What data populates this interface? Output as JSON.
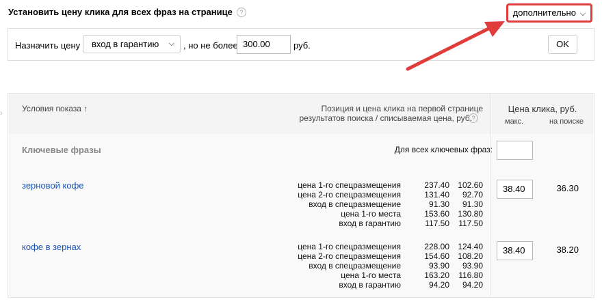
{
  "header": {
    "title": "Установить цену клика для всех фраз на странице",
    "help": "?",
    "advanced_button": "дополнительно"
  },
  "bid_panel": {
    "assign_label": "Назначить цену",
    "strategy_value": "вход в гарантию",
    "not_more_label": ", но не более",
    "max_price_value": "300.00",
    "currency": "руб.",
    "ok_label": "OK"
  },
  "table": {
    "col_conditions": "Условия показа ↑",
    "col_position_line1": "Позиция и цена клика на первой странице",
    "col_position_line2": "результатов поиска / списываемая цена, руб.",
    "col_bid": "Цена клика, руб.",
    "col_bid_max": "макс.",
    "col_bid_search": "на поиске",
    "section_label": "Ключевые фразы",
    "all_phrases_label": "Для всех ключевых фраз:",
    "all_phrases_value": "",
    "rows": [
      {
        "phrase": "зерновой кофе",
        "positions": [
          "цена 1-го спецразмещения",
          "цена 2-го спецразмещения",
          "вход в спецразмещение",
          "цена 1-го места",
          "вход в гарантию"
        ],
        "bids": [
          "237.40",
          "131.40",
          "91.30",
          "153.60",
          "117.50"
        ],
        "charged": [
          "102.60",
          "92.70",
          "91.30",
          "130.80",
          "117.50"
        ],
        "max_bid": "38.40",
        "search_bid": "36.30"
      },
      {
        "phrase": "кофе в зернах",
        "positions": [
          "цена 1-го спецразмещения",
          "цена 2-го спецразмещения",
          "вход в спецразмещение",
          "цена 1-го места",
          "вход в гарантию"
        ],
        "bids": [
          "228.00",
          "154.60",
          "93.90",
          "163.20",
          "94.20"
        ],
        "charged": [
          "124.40",
          "108.20",
          "93.90",
          "116.80",
          "94.20"
        ],
        "max_bid": "38.40",
        "search_bid": "38.20"
      }
    ]
  },
  "icons": {
    "help": "help-circle-icon",
    "dropdown": "chevron-down-icon",
    "annotation": "red-arrow-icon"
  },
  "colors": {
    "annotation": "#e03c3c",
    "link": "#1a52b5"
  }
}
